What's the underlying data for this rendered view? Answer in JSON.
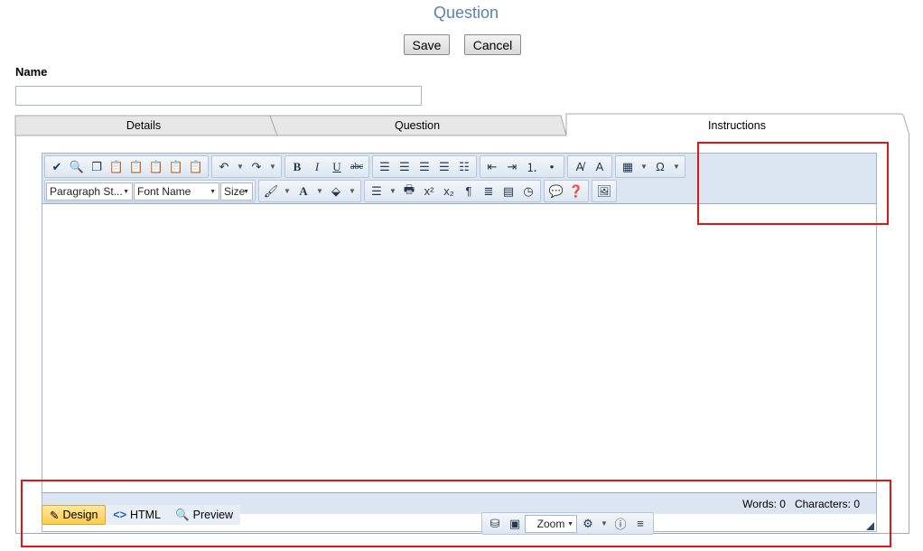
{
  "page": {
    "title": "Question",
    "save_label": "Save",
    "cancel_label": "Cancel"
  },
  "form": {
    "name_label": "Name",
    "name_value": "",
    "name_placeholder": ""
  },
  "tabs": [
    {
      "label": "Details",
      "active": false
    },
    {
      "label": "Question",
      "active": false
    },
    {
      "label": "Instructions",
      "active": true
    }
  ],
  "toolbar": {
    "paragraph_style": "Paragraph St...",
    "font_name": "Font Name",
    "font_size": "Size",
    "row1_icons": [
      "spellcheck-icon",
      "find-icon",
      "copy-icon",
      "paste-icon",
      "paste-text-icon",
      "paste-word-icon",
      "paste-html-icon",
      "paste-plain-icon",
      "undo-icon",
      "redo-icon",
      "bold-icon",
      "italic-icon",
      "underline-icon",
      "strikethrough-icon",
      "align-left-icon",
      "align-center-icon",
      "align-right-icon",
      "justify-icon",
      "remove-alignment-icon",
      "outdent-icon",
      "indent-icon",
      "numbered-list-icon",
      "bulleted-list-icon",
      "format-stripper-icon",
      "css-class-icon",
      "table-icon",
      "symbol-icon"
    ],
    "row2_icons": [
      "format-painter-icon",
      "fore-color-icon",
      "back-color-icon",
      "align-icon",
      "print-icon",
      "superscript-icon",
      "subscript-icon",
      "paragraph-icon",
      "horizontal-rule-icon",
      "insert-date-icon",
      "insert-time-icon",
      "tooltip-icon",
      "help-icon",
      "image-manager-icon"
    ],
    "bold_glyph": "B",
    "italic_glyph": "I",
    "underline_glyph": "U",
    "strike_glyph": "abc",
    "superscript_glyph": "x²",
    "subscript_glyph": "x₂",
    "symbol_glyph": "Ω"
  },
  "status": {
    "words": "Words: 0",
    "characters": "Characters: 0"
  },
  "mode_tabs": [
    {
      "label": "Design",
      "active": true
    },
    {
      "label": "HTML",
      "active": false
    },
    {
      "label": "Preview",
      "active": false
    }
  ],
  "bottom_tools": {
    "zoom_label": "Zoom"
  },
  "colors": {
    "title": "#5b82ad",
    "toolbar_bg": "#dce6f2",
    "highlight": "#e01515",
    "design_tab": "#ffcc4d"
  }
}
